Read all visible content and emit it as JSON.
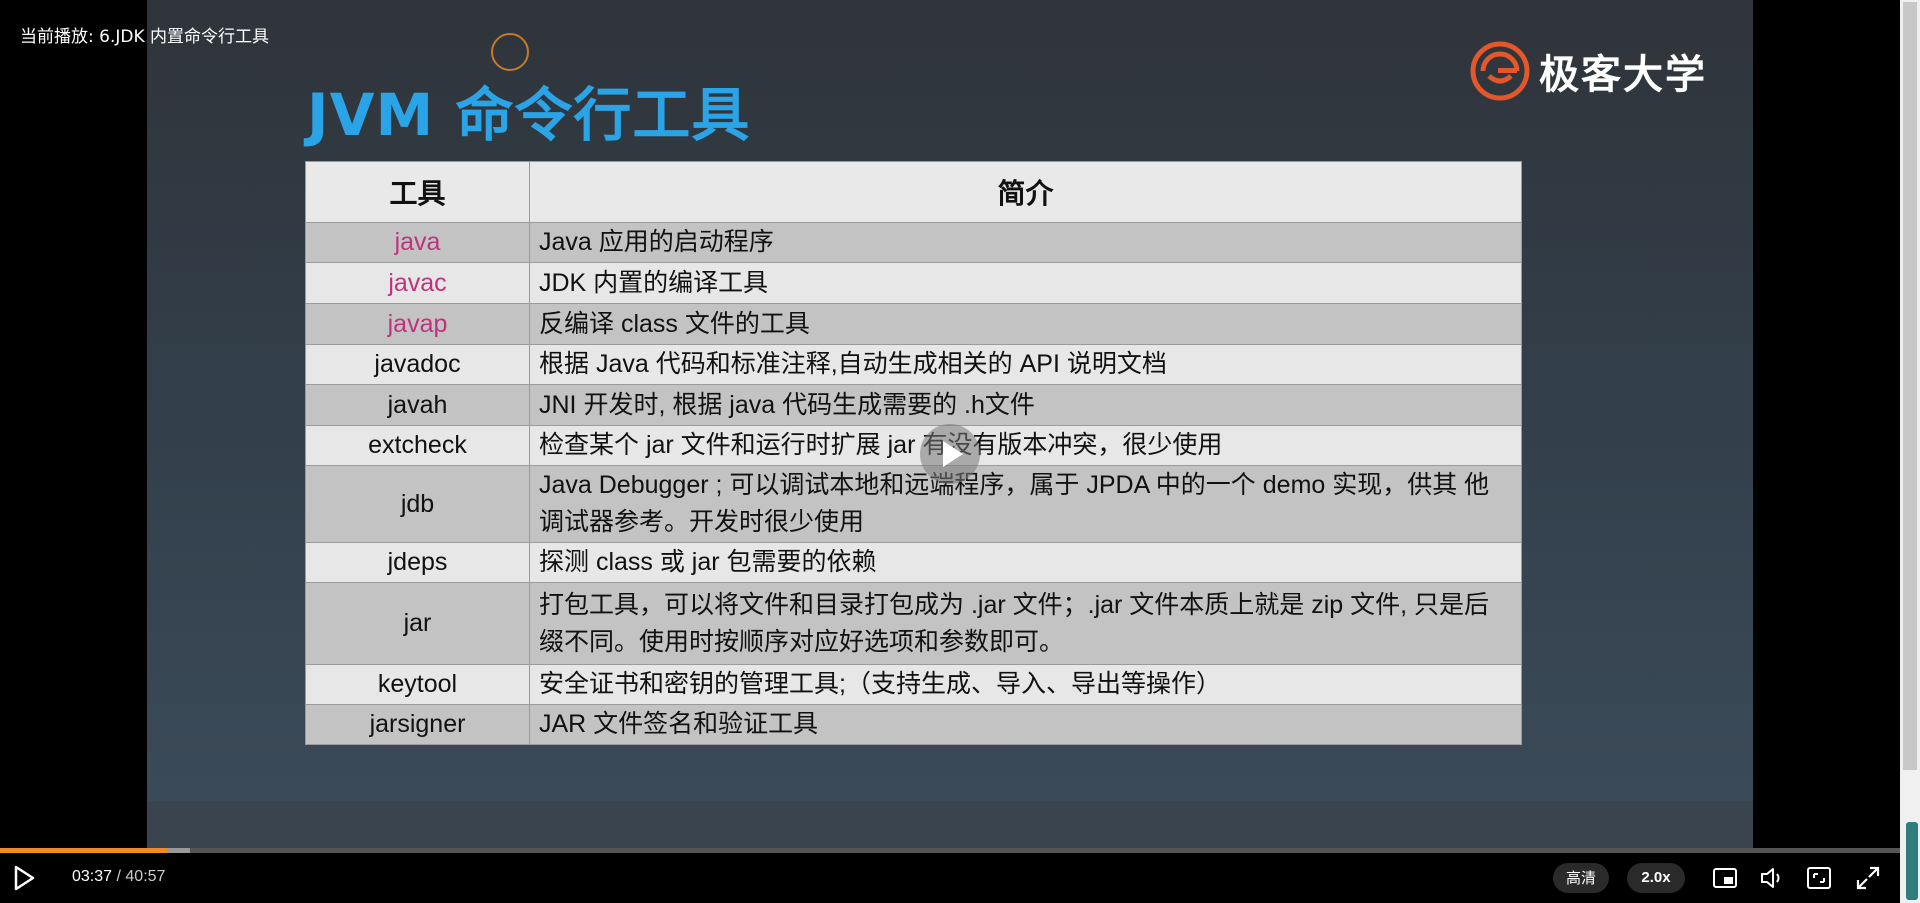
{
  "player": {
    "now_playing": "当前播放: 6.JDK 内置命令行工具",
    "current_time": "03:37",
    "duration": "40:57",
    "separator": " / ",
    "progress_played": 0.088,
    "progress_buffered": 0.1,
    "quality_label": "高清",
    "speed_label": "2.0x",
    "accent_color": "#f08a24"
  },
  "slide": {
    "title": "JVM 命令行工具",
    "brand": "极客大学",
    "title_color": "#2aa4e6",
    "highlight_color": "#c0337c",
    "table": {
      "headers": [
        "工具",
        "简介"
      ],
      "rows": [
        {
          "tool": "java",
          "desc": "Java 应用的启动程序",
          "highlight": true
        },
        {
          "tool": "javac",
          "desc": "JDK 内置的编译工具",
          "highlight": true
        },
        {
          "tool": "javap",
          "desc": "反编译 class 文件的工具",
          "highlight": true
        },
        {
          "tool": "javadoc",
          "desc": "根据 Java 代码和标准注释,自动生成相关的 API 说明文档",
          "highlight": false
        },
        {
          "tool": "javah",
          "desc": "JNI 开发时, 根据 java 代码生成需要的 .h文件",
          "highlight": false
        },
        {
          "tool": "extcheck",
          "desc": "检查某个 jar 文件和运行时扩展 jar 有没有版本冲突，很少使用",
          "highlight": false
        },
        {
          "tool": "jdb",
          "desc": "Java Debugger ; 可以调试本地和远端程序，属于 JPDA 中的一个 demo 实现，供其  他调试器参考。开发时很少使用",
          "highlight": false
        },
        {
          "tool": "jdeps",
          "desc": "探测 class 或  jar 包需要的依赖",
          "highlight": false
        },
        {
          "tool": "jar",
          "desc": "打包工具，可以将文件和目录打包成为 .jar 文件；.jar 文件本质上就是 zip 文件, 只是后缀不同。使用时按顺序对应好选项和参数即可。",
          "highlight": false
        },
        {
          "tool": "keytool",
          "desc": "安全证书和密钥的管理工具;（支持生成、导入、导出等操作）",
          "highlight": false
        },
        {
          "tool": "jarsigner",
          "desc": "JAR 文件签名和验证工具",
          "highlight": false
        }
      ]
    }
  },
  "icons": {
    "play": "play-icon",
    "pip": "picture-in-picture-icon",
    "volume": "volume-icon",
    "webfullscreen": "web-fullscreen-icon",
    "fullscreen": "fullscreen-icon",
    "center_play": "center-play-icon"
  }
}
